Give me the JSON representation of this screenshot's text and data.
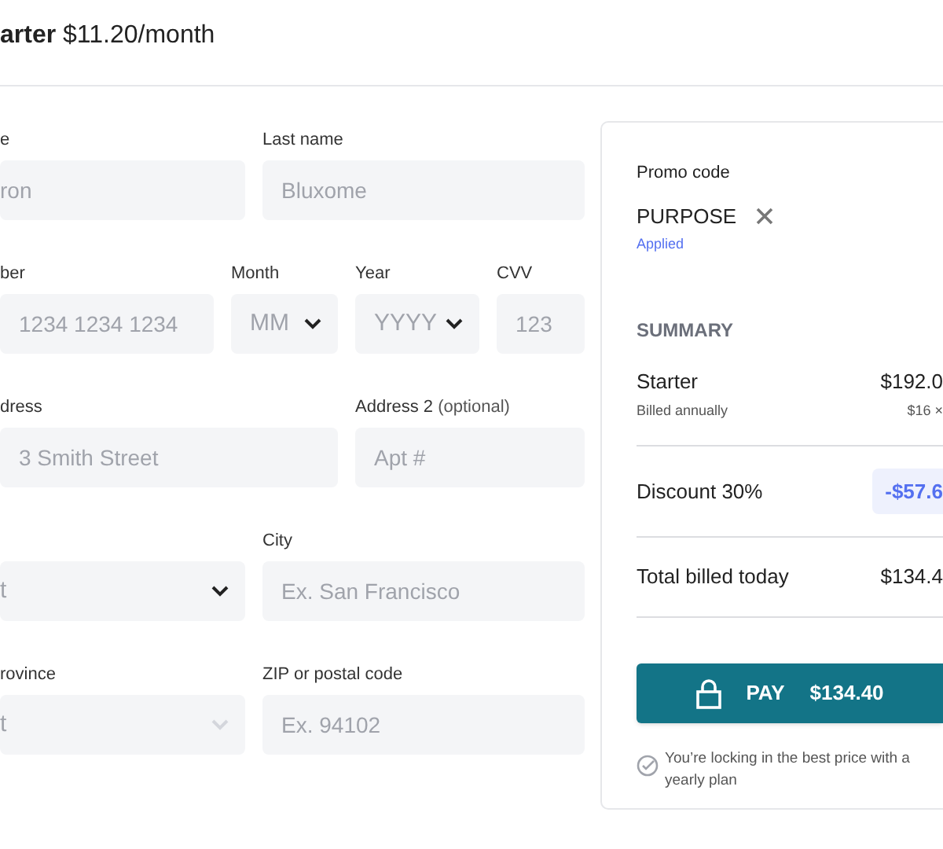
{
  "header": {
    "plan": "arter",
    "price": "$11.20/month"
  },
  "form_rows": [
    {
      "fields": [
        {
          "label": "e",
          "kind": "text",
          "value": "ron"
        },
        {
          "label": "Last name",
          "kind": "text",
          "placeholder": "Bluxome"
        }
      ]
    },
    {
      "fields": [
        {
          "label": "ber",
          "kind": "text",
          "placeholder": "1234 1234 1234"
        },
        {
          "label": "Month",
          "kind": "select",
          "placeholder": "MM",
          "disabled": false
        },
        {
          "label": "Year",
          "kind": "select",
          "placeholder": "YYYY",
          "disabled": false
        },
        {
          "label": "CVV",
          "kind": "text",
          "placeholder": "123"
        }
      ]
    },
    {
      "fields": [
        {
          "label": "dress",
          "kind": "text",
          "placeholder": "3 Smith Street"
        },
        {
          "label": "Address 2",
          "hint": "(optional)",
          "kind": "text",
          "placeholder": "Apt #"
        }
      ]
    },
    {
      "fields": [
        {
          "kind": "select",
          "value": "t",
          "disabled": false
        },
        {
          "label": "City",
          "kind": "text",
          "placeholder": "Ex. San Francisco"
        }
      ]
    },
    {
      "fields": [
        {
          "label": "rovince",
          "kind": "select",
          "value": "t",
          "disabled": true
        },
        {
          "label": "ZIP or postal code",
          "kind": "text",
          "placeholder": "Ex. 94102"
        }
      ]
    }
  ],
  "summary_card": {
    "promo_label": "Promo code",
    "promo_code": "PURPOSE",
    "promo_status": "Applied",
    "summary_title": "SUMMARY",
    "lines": [
      {
        "kind": "plan",
        "label": "Starter",
        "amount": "$192.0",
        "sublabel": "Billed annually",
        "subamount": "$16 ×"
      },
      {
        "kind": "discount",
        "label": "Discount 30%",
        "amount": "-$57.6"
      },
      {
        "kind": "total",
        "label": "Total billed today",
        "amount": "$134.4"
      }
    ],
    "pay_button": {
      "label": "PAY",
      "amount": "$134.40"
    },
    "note": "You’re locking in the best price with a yearly plan"
  }
}
